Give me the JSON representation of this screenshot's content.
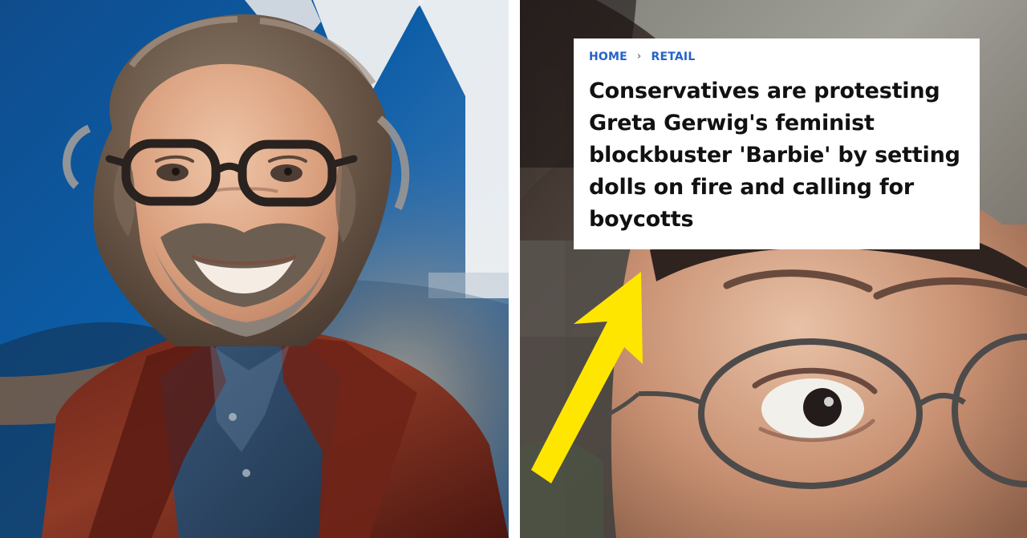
{
  "article_preview": {
    "breadcrumbs": [
      "HOME",
      "RETAIL"
    ],
    "headline": "Conservatives are protesting Greta Gerwig's feminist blockbuster 'Barbie' by setting dolls on fire and calling for boycotts"
  },
  "colors": {
    "breadcrumb_link": "#2563c9",
    "headline_text": "#111111",
    "arrow": "#ffe600",
    "card_background": "#ffffff"
  },
  "icons": {
    "breadcrumb_separator": "chevron-right-icon",
    "pointer": "yellow-arrow-icon"
  }
}
